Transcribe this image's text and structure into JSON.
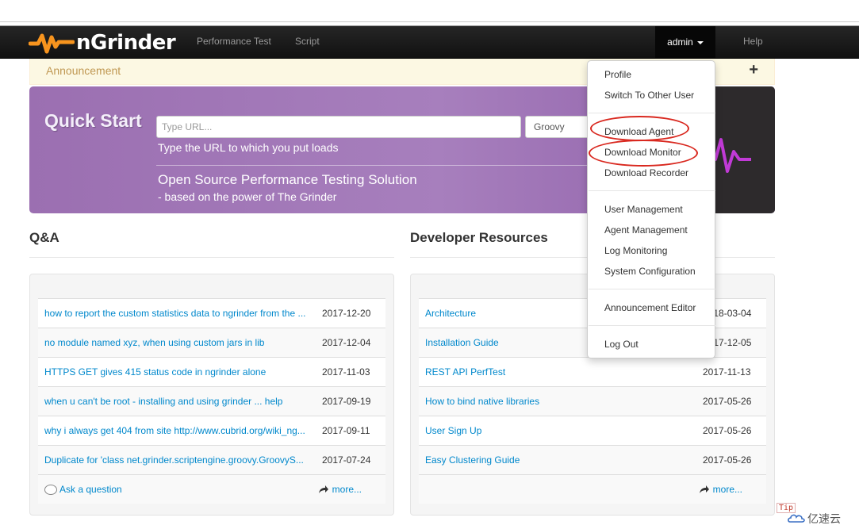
{
  "navbar": {
    "brand": "nGrinder",
    "links": [
      "Performance Test",
      "Script"
    ],
    "user": "admin",
    "help": "Help"
  },
  "announcement": {
    "title": "Announcement",
    "toggle": "+"
  },
  "quick_start": {
    "title": "Quick Start",
    "url_placeholder": "Type URL...",
    "script_type": "Groovy",
    "hint": "Type the URL to which you put loads",
    "tagline": "Open Source Performance Testing Solution",
    "tagline_sub": "- based on the power of The Grinder"
  },
  "qa": {
    "title": "Q&A",
    "rows": [
      {
        "title": "how to report the custom statistics data to ngrinder from the ...",
        "date": "2017-12-20"
      },
      {
        "title": "no module named xyz, when using custom jars in lib",
        "date": "2017-12-04"
      },
      {
        "title": "HTTPS GET gives 415 status code in ngrinder alone",
        "date": "2017-11-03"
      },
      {
        "title": "when u can't be root - installing and using grinder ... help",
        "date": "2017-09-19"
      },
      {
        "title": "why i always get 404 from site http://www.cubrid.org/wiki_ng...",
        "date": "2017-09-11"
      },
      {
        "title": "Duplicate for 'class net.grinder.scriptengine.groovy.GroovyS...",
        "date": "2017-07-24"
      }
    ],
    "ask": "Ask a question",
    "more": "more..."
  },
  "dev": {
    "title": "Developer Resources",
    "rows": [
      {
        "title": "Architecture",
        "date": "2018-03-04"
      },
      {
        "title": "Installation Guide",
        "date": "2017-12-05"
      },
      {
        "title": "REST API PerfTest",
        "date": "2017-11-13"
      },
      {
        "title": "How to bind native libraries",
        "date": "2017-05-26"
      },
      {
        "title": "User Sign Up",
        "date": "2017-05-26"
      },
      {
        "title": "Easy Clustering Guide",
        "date": "2017-05-26"
      }
    ],
    "more": "more..."
  },
  "user_menu": {
    "profile": "Profile",
    "switch_user": "Switch To Other User",
    "download_agent": "Download Agent",
    "download_monitor": "Download Monitor",
    "download_recorder": "Download Recorder",
    "user_management": "User Management",
    "agent_management": "Agent Management",
    "log_monitoring": "Log Monitoring",
    "system_configuration": "System Configuration",
    "announcement_editor": "Announcement Editor",
    "log_out": "Log Out"
  },
  "overlay": {
    "tip": "Tip",
    "watermark": "亿速云"
  },
  "colors": {
    "brand_orange": "#f7941e",
    "link": "#0088cc",
    "annotation_red": "#d9281f",
    "quickstart_purple": "#a77fbd"
  }
}
